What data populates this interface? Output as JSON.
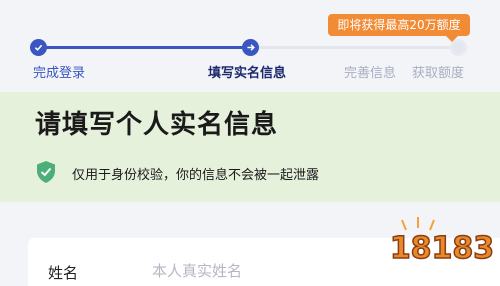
{
  "promo": {
    "text": "即将获得最高20万额度"
  },
  "steps": [
    {
      "label": "完成登录",
      "state": "done"
    },
    {
      "label": "填写实名信息",
      "state": "active"
    },
    {
      "label": "完善信息",
      "state": "todo"
    },
    {
      "label": "获取额度",
      "state": "todo"
    }
  ],
  "icons": {
    "done": "checkmark-icon",
    "active": "arrow-right-icon",
    "notice": "shield-check-icon"
  },
  "section": {
    "heading": "请填写个人实名信息",
    "notice": "仅用于身份校验，你的信息不会被一起泄露"
  },
  "form": {
    "name_label": "姓名",
    "name_placeholder": "本人真实姓名"
  },
  "watermark": {
    "text": "18183"
  },
  "colors": {
    "brand": "#3a56c0",
    "promo": "#f28b35",
    "notice_green": "#4caf7a"
  }
}
